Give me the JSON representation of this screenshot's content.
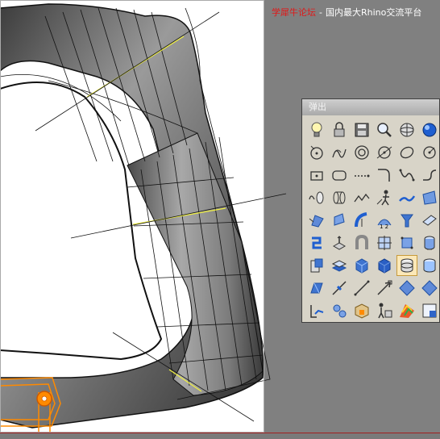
{
  "watermark": {
    "brand": "学犀牛论坛",
    "separator": "-",
    "rest": "国内最大Rhino交流平台"
  },
  "toolbar": {
    "title": "弹出",
    "active_tool": "cylinder-icon",
    "tools": [
      "light-bulb-icon",
      "lock-icon",
      "save-icon",
      "zoom-extents-icon",
      "render-sphere-icon",
      "shaded-sphere-icon",
      "circle-point-icon",
      "helix-curve-icon",
      "concentric-circle-icon",
      "circle-tangent-icon",
      "ellipse-icon",
      "circle-arc-icon",
      "rectangle-point-icon",
      "rounded-rectangle-icon",
      "dashed-line-icon",
      "fillet-curve-icon",
      "spline-curve-icon",
      "curve-blend-icon",
      "extrude-curve-icon",
      "loft-icon",
      "polyline-icon",
      "person-tool-icon",
      "blend-surface-icon",
      "patch-surface-icon",
      "sweep-surface-icon",
      "edge-surface-icon",
      "revolve-surface-icon",
      "network-surface-icon",
      "funnel-icon",
      "plane-surface-icon",
      "join-icon",
      "extrude-solid-icon",
      "pipe-icon",
      "box-frame-icon",
      "box-points-icon",
      "cylinder-gear-icon",
      "boolean-union-icon",
      "layers-icon",
      "solid-box-icon",
      "cube-icon",
      "cylinder-icon",
      "sphere-icon",
      "fillet-edge-icon",
      "shell-icon",
      "line-tool-icon",
      "arrow-line-icon",
      "gumball-icon",
      "diamond-icon",
      "flag-icon",
      "gear-icon",
      "package-icon",
      "person-render-icon",
      "rainbow-analysis-icon",
      "viewport-icon"
    ]
  },
  "colors": {
    "viewport_bg": "#808080",
    "canvas_bg": "#ffffff",
    "selection_orange": "#ff8a00",
    "isocurve_yellow": "#f0f040",
    "watermark_red": "#e01818"
  }
}
